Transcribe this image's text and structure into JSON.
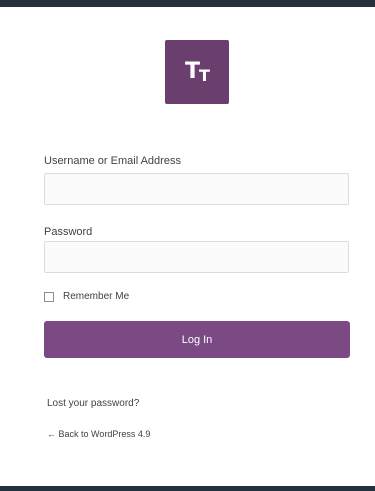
{
  "logo": {
    "text_big": "T",
    "text_small": "T"
  },
  "form": {
    "username_label": "Username or Email Address",
    "username_value": "",
    "password_label": "Password",
    "password_value": "",
    "remember_label": "Remember Me",
    "login_button": "Log In"
  },
  "links": {
    "lost_password": "Lost your password?",
    "back_to_site": "← Back to WordPress 4.9"
  },
  "colors": {
    "accent": "#7b4a84",
    "logo_bg": "#6a3f6e",
    "border_dark": "#24313d"
  }
}
